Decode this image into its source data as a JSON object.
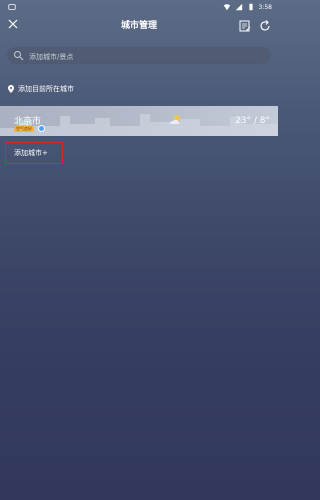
{
  "status_bar": {
    "time": "3:58"
  },
  "header": {
    "title": "城市管理"
  },
  "search": {
    "placeholder": "添加城市/景点"
  },
  "locate": {
    "label": "添加目前所在城市"
  },
  "city_card": {
    "name": "北京市",
    "badge": "空气良好",
    "temperature": "23° / 8°"
  },
  "add_city": {
    "label": "添加城市+"
  },
  "colors": {
    "highlight_border": "#d2292e",
    "location_dot": "#4aa3ff",
    "badge_bg": "#f2b13b"
  }
}
